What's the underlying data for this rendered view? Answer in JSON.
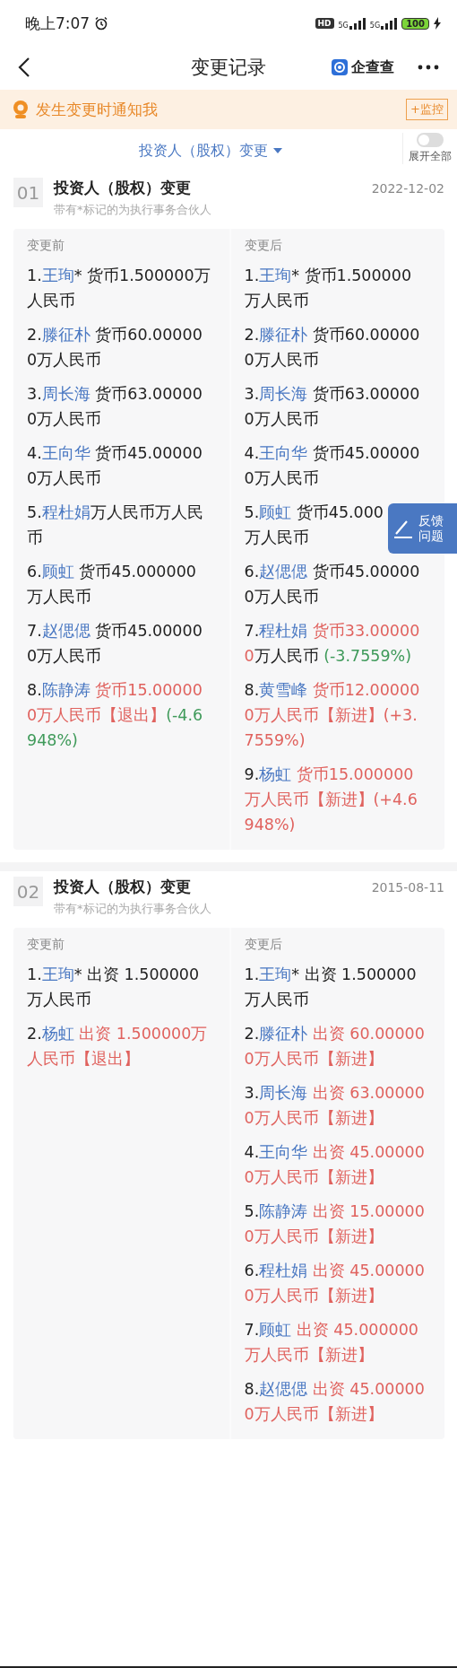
{
  "status_bar": {
    "time": "晚上7:07",
    "hd": "HD",
    "networks": [
      "5G",
      "5G"
    ],
    "battery": "100",
    "charging": true
  },
  "header": {
    "title": "变更记录",
    "brand": "企查查"
  },
  "banner": {
    "text": "发生变更时通知我",
    "button": "+监控"
  },
  "filter": {
    "label": "投资人（股权）变更",
    "expand_all": {
      "label": "展开全部",
      "on": false
    }
  },
  "records": [
    {
      "number": "01",
      "title": "投资人（股权）变更",
      "date": "2022-12-02",
      "note": "带有*标记的为执行事务合伙人",
      "before_label": "变更前",
      "after_label": "变更后",
      "before": [
        {
          "parts": [
            {
              "kind": "plain",
              "text": "1."
            },
            {
              "kind": "name",
              "text": "王珣"
            },
            {
              "kind": "plain",
              "text": "* 货币1.500000万人民币"
            }
          ]
        },
        {
          "parts": [
            {
              "kind": "plain",
              "text": "2."
            },
            {
              "kind": "name",
              "text": "滕征朴"
            },
            {
              "kind": "plain",
              "text": " 货币60.000000万人民币"
            }
          ]
        },
        {
          "parts": [
            {
              "kind": "plain",
              "text": "3."
            },
            {
              "kind": "name",
              "text": "周长海"
            },
            {
              "kind": "plain",
              "text": " 货币63.000000万人民币"
            }
          ]
        },
        {
          "parts": [
            {
              "kind": "plain",
              "text": "4."
            },
            {
              "kind": "name",
              "text": "王向华"
            },
            {
              "kind": "plain",
              "text": " 货币45.000000万人民币"
            }
          ]
        },
        {
          "parts": [
            {
              "kind": "plain",
              "text": "5."
            },
            {
              "kind": "name",
              "text": "程杜娟"
            },
            {
              "kind": "plain",
              "text": "万人民币万人民币"
            }
          ]
        },
        {
          "parts": [
            {
              "kind": "plain",
              "text": "6."
            },
            {
              "kind": "name",
              "text": "顾虹"
            },
            {
              "kind": "plain",
              "text": " 货币45.000000万人民币"
            }
          ]
        },
        {
          "parts": [
            {
              "kind": "plain",
              "text": "7."
            },
            {
              "kind": "name",
              "text": "赵偲偲"
            },
            {
              "kind": "plain",
              "text": " 货币45.000000万人民币"
            }
          ]
        },
        {
          "parts": [
            {
              "kind": "plain",
              "text": "8."
            },
            {
              "kind": "name",
              "text": "陈静涛"
            },
            {
              "kind": "red",
              "text": " 货币15.000000万人民币【退出】"
            },
            {
              "kind": "green",
              "text": "(-4.6948%)"
            }
          ]
        }
      ],
      "after": [
        {
          "parts": [
            {
              "kind": "plain",
              "text": "1."
            },
            {
              "kind": "name",
              "text": "王珣"
            },
            {
              "kind": "plain",
              "text": "* 货币1.500000万人民币"
            }
          ]
        },
        {
          "parts": [
            {
              "kind": "plain",
              "text": "2."
            },
            {
              "kind": "name",
              "text": "滕征朴"
            },
            {
              "kind": "plain",
              "text": " 货币60.000000万人民币"
            }
          ]
        },
        {
          "parts": [
            {
              "kind": "plain",
              "text": "3."
            },
            {
              "kind": "name",
              "text": "周长海"
            },
            {
              "kind": "plain",
              "text": " 货币63.000000万人民币"
            }
          ]
        },
        {
          "parts": [
            {
              "kind": "plain",
              "text": "4."
            },
            {
              "kind": "name",
              "text": "王向华"
            },
            {
              "kind": "plain",
              "text": " 货币45.000000万人民币"
            }
          ]
        },
        {
          "parts": [
            {
              "kind": "plain",
              "text": "5."
            },
            {
              "kind": "name",
              "text": "顾虹"
            },
            {
              "kind": "plain",
              "text": " 货币45.000"
            },
            {
              "kind": "break"
            },
            {
              "kind": "plain",
              "text": "万人民币"
            }
          ]
        },
        {
          "parts": [
            {
              "kind": "plain",
              "text": "6."
            },
            {
              "kind": "name",
              "text": "赵偲偲"
            },
            {
              "kind": "plain",
              "text": " 货币45.000000万人民币"
            }
          ]
        },
        {
          "parts": [
            {
              "kind": "plain",
              "text": "7."
            },
            {
              "kind": "name",
              "text": "程杜娟"
            },
            {
              "kind": "red",
              "text": " 货币33.000000"
            },
            {
              "kind": "plain",
              "text": "万人民币 "
            },
            {
              "kind": "green",
              "text": "(-3.7559%)"
            }
          ]
        },
        {
          "parts": [
            {
              "kind": "plain",
              "text": "8."
            },
            {
              "kind": "name",
              "text": "黄雪峰"
            },
            {
              "kind": "red",
              "text": " 货币12.000000万人民币【新进】(+3.7559%)"
            }
          ]
        },
        {
          "parts": [
            {
              "kind": "plain",
              "text": "9."
            },
            {
              "kind": "name",
              "text": "杨虹"
            },
            {
              "kind": "red",
              "text": " 货币15.000000万人民币【新进】(+4.6948%)"
            }
          ]
        }
      ]
    },
    {
      "number": "02",
      "title": "投资人（股权）变更",
      "date": "2015-08-11",
      "note": "带有*标记的为执行事务合伙人",
      "before_label": "变更前",
      "after_label": "变更后",
      "before": [
        {
          "parts": [
            {
              "kind": "plain",
              "text": "1."
            },
            {
              "kind": "name",
              "text": "王珣"
            },
            {
              "kind": "plain",
              "text": "* 出资 1.500000万人民币"
            }
          ]
        },
        {
          "parts": [
            {
              "kind": "plain",
              "text": "2."
            },
            {
              "kind": "name",
              "text": "杨虹"
            },
            {
              "kind": "red",
              "text": " 出资 1.500000万人民币【退出】"
            }
          ]
        }
      ],
      "after": [
        {
          "parts": [
            {
              "kind": "plain",
              "text": "1."
            },
            {
              "kind": "name",
              "text": "王珣"
            },
            {
              "kind": "plain",
              "text": "* 出资 1.500000万人民币"
            }
          ]
        },
        {
          "parts": [
            {
              "kind": "plain",
              "text": "2."
            },
            {
              "kind": "name",
              "text": "滕征朴"
            },
            {
              "kind": "red",
              "text": " 出资 60.000000万人民币【新进】"
            }
          ]
        },
        {
          "parts": [
            {
              "kind": "plain",
              "text": "3."
            },
            {
              "kind": "name",
              "text": "周长海"
            },
            {
              "kind": "red",
              "text": " 出资 63.000000万人民币【新进】"
            }
          ]
        },
        {
          "parts": [
            {
              "kind": "plain",
              "text": "4."
            },
            {
              "kind": "name",
              "text": "王向华"
            },
            {
              "kind": "red",
              "text": " 出资 45.000000万人民币【新进】"
            }
          ]
        },
        {
          "parts": [
            {
              "kind": "plain",
              "text": "5."
            },
            {
              "kind": "name",
              "text": "陈静涛"
            },
            {
              "kind": "red",
              "text": " 出资 15.000000万人民币【新进】"
            }
          ]
        },
        {
          "parts": [
            {
              "kind": "plain",
              "text": "6."
            },
            {
              "kind": "name",
              "text": "程杜娟"
            },
            {
              "kind": "red",
              "text": " 出资 45.000000万人民币【新进】"
            }
          ]
        },
        {
          "parts": [
            {
              "kind": "plain",
              "text": "7."
            },
            {
              "kind": "name",
              "text": "顾虹"
            },
            {
              "kind": "red",
              "text": " 出资 45.000000万人民币【新进】"
            }
          ]
        },
        {
          "parts": [
            {
              "kind": "plain",
              "text": "8."
            },
            {
              "kind": "name",
              "text": "赵偲偲"
            },
            {
              "kind": "red",
              "text": " 出资 45.000000万人民币【新进】"
            }
          ]
        }
      ]
    }
  ],
  "feedback": {
    "text": "反馈问题"
  }
}
